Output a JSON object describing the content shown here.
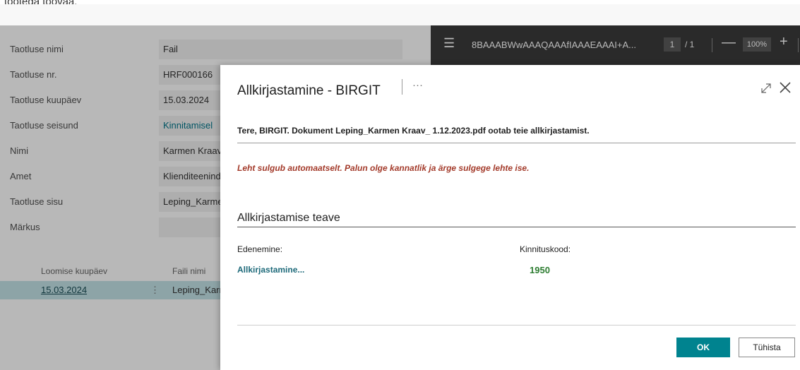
{
  "background": {
    "top_text": "tootega töövaa.",
    "fields": [
      {
        "label": "Taotluse nimi",
        "value": "Fail",
        "is_link": false
      },
      {
        "label": "Taotluse nr.",
        "value": "HRF000166",
        "is_link": false
      },
      {
        "label": "Taotluse kuupäev",
        "value": "15.03.2024",
        "is_link": false
      },
      {
        "label": "Taotluse seisund",
        "value": "Kinnitamisel",
        "is_link": true
      },
      {
        "label": "Nimi",
        "value": "Karmen Kraav",
        "is_link": false
      },
      {
        "label": "Amet",
        "value": "Klienditeenind",
        "is_link": false
      },
      {
        "label": "Taotluse sisu",
        "value": "Leping_Karme",
        "is_link": false
      },
      {
        "label": "Märkus",
        "value": "",
        "is_link": false
      }
    ],
    "grid": {
      "headers": [
        "Loomise kuupäev",
        "Faili nimi"
      ],
      "row": {
        "date": "15.03.2024",
        "menu": "⋮",
        "file": "Leping_Karr"
      }
    }
  },
  "pdf_viewer": {
    "menu_icon": "hamburger-icon",
    "document_name": "8BAAABWwAAAQAAAfIAAAEAAAI+A...",
    "page_current": "1",
    "page_total": "/ 1",
    "zoom": "100%"
  },
  "dialog": {
    "title": "Allkirjastamine - BIRGIT",
    "more_label": "···",
    "greeting": "Tere, BIRGIT. Dokument Leping_Karmen Kraav_ 1.12.2023.pdf ootab teie allkirjastamist.",
    "warning": "Leht sulgub automaatselt. Palun olge kannatlik ja ärge sulgege lehte ise.",
    "section_title": "Allkirjastamise teave",
    "progress_label": "Edenemine:",
    "progress_value": "Allkirjastamine...",
    "code_label": "Kinnituskood:",
    "code_value": "1950",
    "ok_label": "OK",
    "cancel_label": "Tühista",
    "colors": {
      "accent": "#00838f",
      "warning": "#a33a2a",
      "code": "#2e7d32"
    }
  }
}
